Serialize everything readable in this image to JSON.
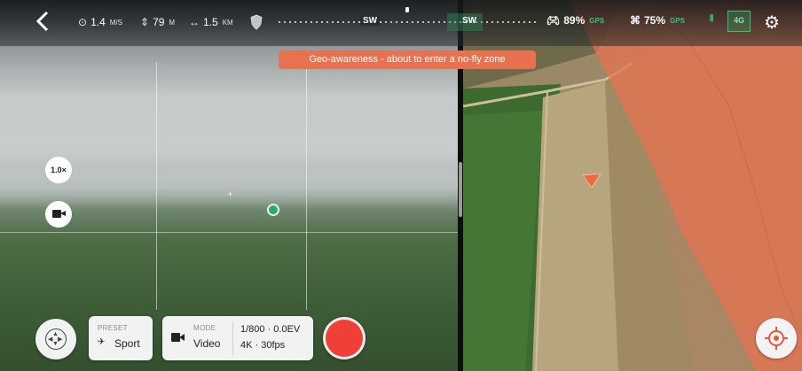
{
  "top_bar": {
    "back_icon": "chevron-left-icon",
    "speed": {
      "icon": "speedometer-icon",
      "value": "1.4",
      "unit": "M/S"
    },
    "altitude": {
      "icon": "altitude-icon",
      "value": "79",
      "unit": "M"
    },
    "distance": {
      "icon": "distance-icon",
      "value": "1.5",
      "unit": "KM"
    },
    "compass": {
      "heading_primary": "SW",
      "heading_drone": "SW"
    },
    "controller_battery": {
      "icon": "controller-icon",
      "value": "89%",
      "status": "GPS"
    },
    "drone_battery": {
      "icon": "drone-icon",
      "value": "75%",
      "status": "GPS"
    },
    "network_badge": "4G",
    "settings_icon": "gear-icon"
  },
  "alert": {
    "text": "Geo-awareness - about to enter a no-fly zone",
    "color": "#e8714f"
  },
  "left_controls": {
    "zoom_label": "1.0×",
    "camera_icon": "video-camera-icon"
  },
  "bottom_bar": {
    "joystick_icon": "joystick-icon",
    "preset": {
      "label": "PRESET",
      "value": "Sport",
      "icon": "drone-icon"
    },
    "mode": {
      "label": "MODE",
      "value": "Video",
      "icon": "video-camera-icon"
    },
    "exposure": "1/800 · 0.0EV",
    "resolution": "4K · 30fps",
    "record_icon": "record-button-icon",
    "record_color": "#ee4037"
  },
  "map": {
    "locate_icon": "locate-icon",
    "no_fly_color": "#e8714f",
    "drone_marker_color": "#f06a3c"
  }
}
